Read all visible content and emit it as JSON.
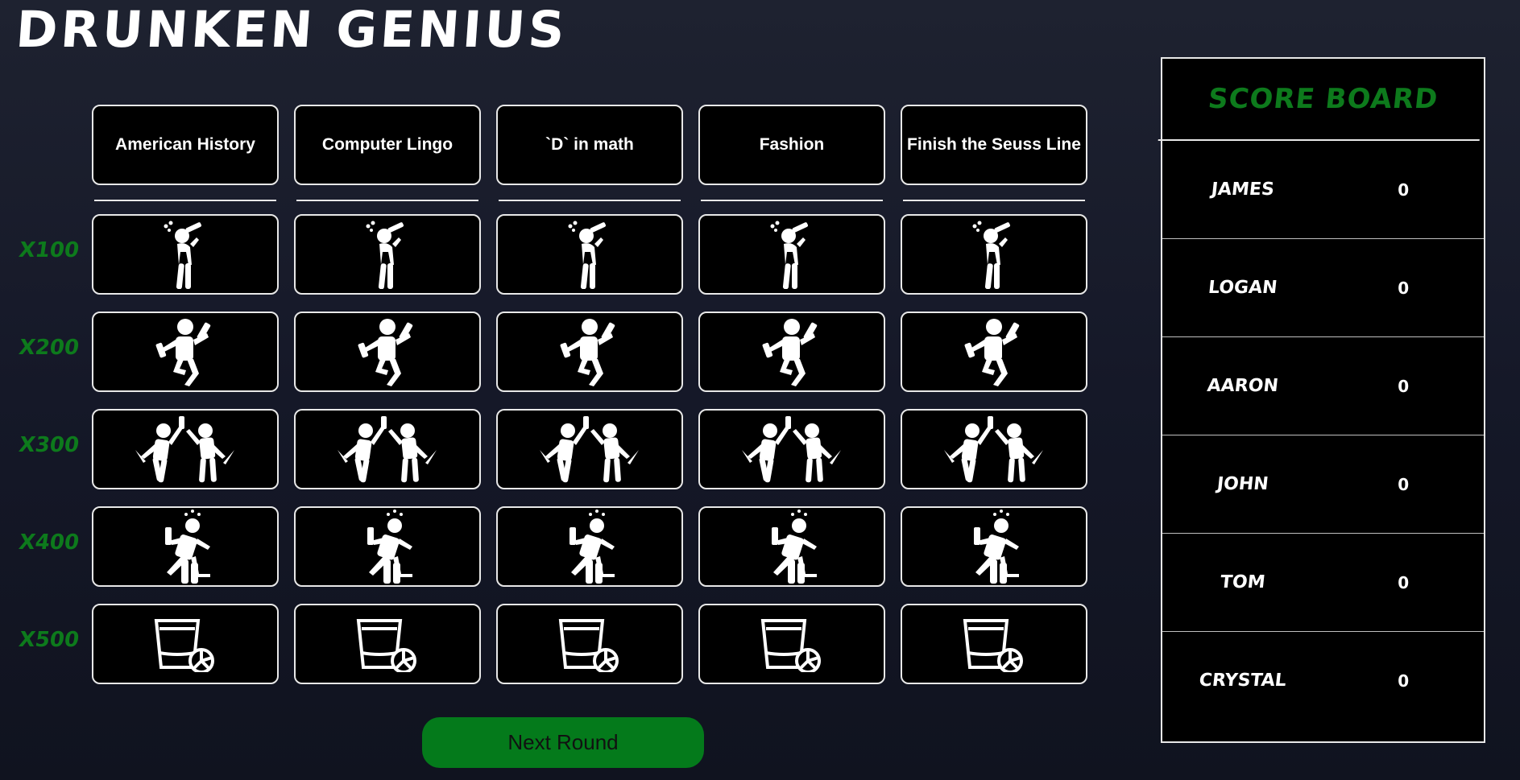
{
  "app": {
    "title": "Drunken Genius"
  },
  "categories": [
    "American History",
    "Computer Lingo",
    "`D` in math",
    "Fashion",
    "Finish the Seuss Line"
  ],
  "rows": [
    {
      "label": "x100",
      "icon": "drinking-person-icon"
    },
    {
      "label": "x200",
      "icon": "dancing-person-icon"
    },
    {
      "label": "x300",
      "icon": "two-people-toasting-icon"
    },
    {
      "label": "x400",
      "icon": "stumbling-drunk-icon"
    },
    {
      "label": "x500",
      "icon": "shot-glass-lime-icon"
    }
  ],
  "controls": {
    "next_round_label": "Next Round"
  },
  "scoreboard": {
    "title": "Score Board",
    "players": [
      {
        "name": "James",
        "score": "0"
      },
      {
        "name": "Logan",
        "score": "0"
      },
      {
        "name": "Aaron",
        "score": "0"
      },
      {
        "name": "John",
        "score": "0"
      },
      {
        "name": "Tom",
        "score": "0"
      },
      {
        "name": "Crystal",
        "score": "0"
      }
    ]
  },
  "colors": {
    "accent_green": "#0d7a1c",
    "button_green": "#047a1b",
    "cell_background": "#000000",
    "border": "#e8e8e8"
  }
}
